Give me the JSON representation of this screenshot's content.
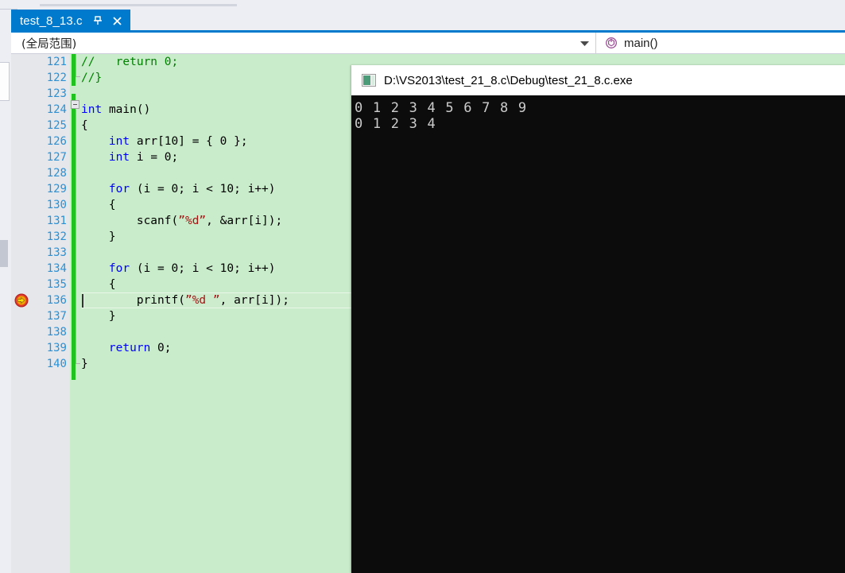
{
  "window": {
    "tab": {
      "title": "test_8_13.c",
      "pin_icon": "pin-icon",
      "close_icon": "close-icon"
    },
    "navbar": {
      "scope_value": "(全局范围)",
      "scope_arrow_icon": "chevron-down-icon",
      "member_value": "main()",
      "member_icon": "method-icon"
    }
  },
  "editor": {
    "first_line_number": 121,
    "current_line": 136,
    "breakpoint_glyph": "current-statement-breakpoint-icon",
    "colors": {
      "background": "#c9ecca",
      "gutter": "#e6e7eb",
      "line_number": "#2b91d4",
      "change_bar": "#1fc21f",
      "keyword": "#0000ff",
      "string": "#a31515",
      "comment": "#008000",
      "accent": "#007acc"
    },
    "lines": [
      {
        "n": "121",
        "text": "//\treturn 0;"
      },
      {
        "n": "122",
        "text": "//}"
      },
      {
        "n": "123",
        "text": ""
      },
      {
        "n": "124",
        "text": "int main()"
      },
      {
        "n": "125",
        "text": "{"
      },
      {
        "n": "126",
        "text": "    int arr[10] = { 0 };"
      },
      {
        "n": "127",
        "text": "    int i = 0;"
      },
      {
        "n": "128",
        "text": ""
      },
      {
        "n": "129",
        "text": "    for (i = 0; i < 10; i++)"
      },
      {
        "n": "130",
        "text": "    {"
      },
      {
        "n": "131",
        "text": "        scanf(\"%d\", &arr[i]);"
      },
      {
        "n": "132",
        "text": "    }"
      },
      {
        "n": "133",
        "text": ""
      },
      {
        "n": "134",
        "text": "    for (i = 0; i < 10; i++)"
      },
      {
        "n": "135",
        "text": "    {"
      },
      {
        "n": "136",
        "text": "        printf(\"%d \", arr[i]);"
      },
      {
        "n": "137",
        "text": "    }"
      },
      {
        "n": "138",
        "text": ""
      },
      {
        "n": "139",
        "text": "    return 0;"
      },
      {
        "n": "140",
        "text": "}"
      }
    ]
  },
  "console": {
    "app_icon": "console-app-icon",
    "title": "D:\\VS2013\\test_21_8.c\\Debug\\test_21_8.c.exe",
    "output_lines": [
      "0 1 2 3 4 5 6 7 8 9",
      "0 1 2 3 4"
    ],
    "background": "#0c0c0c",
    "text_color": "#cccccc"
  }
}
